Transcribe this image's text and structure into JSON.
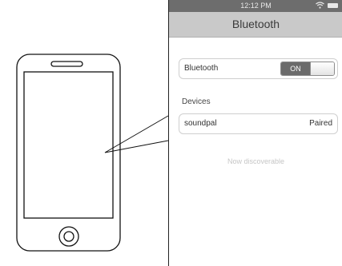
{
  "status_bar": {
    "time": "12:12 PM"
  },
  "nav": {
    "title": "Bluetooth"
  },
  "bluetooth_setting": {
    "label": "Bluetooth",
    "toggle_state": "ON"
  },
  "devices_section": {
    "header": "Devices",
    "items": [
      {
        "name": "soundpal",
        "status": "Paired"
      }
    ]
  },
  "footer_text": "Now discoverable",
  "icons": [
    "wifi-icon",
    "battery-icon",
    "home-button-icon",
    "phone-illustration"
  ],
  "colors": {
    "status_bar": "#6d6d6d",
    "nav_bar": "#c9c9c9",
    "toggle_on": "#6b6b6b"
  }
}
